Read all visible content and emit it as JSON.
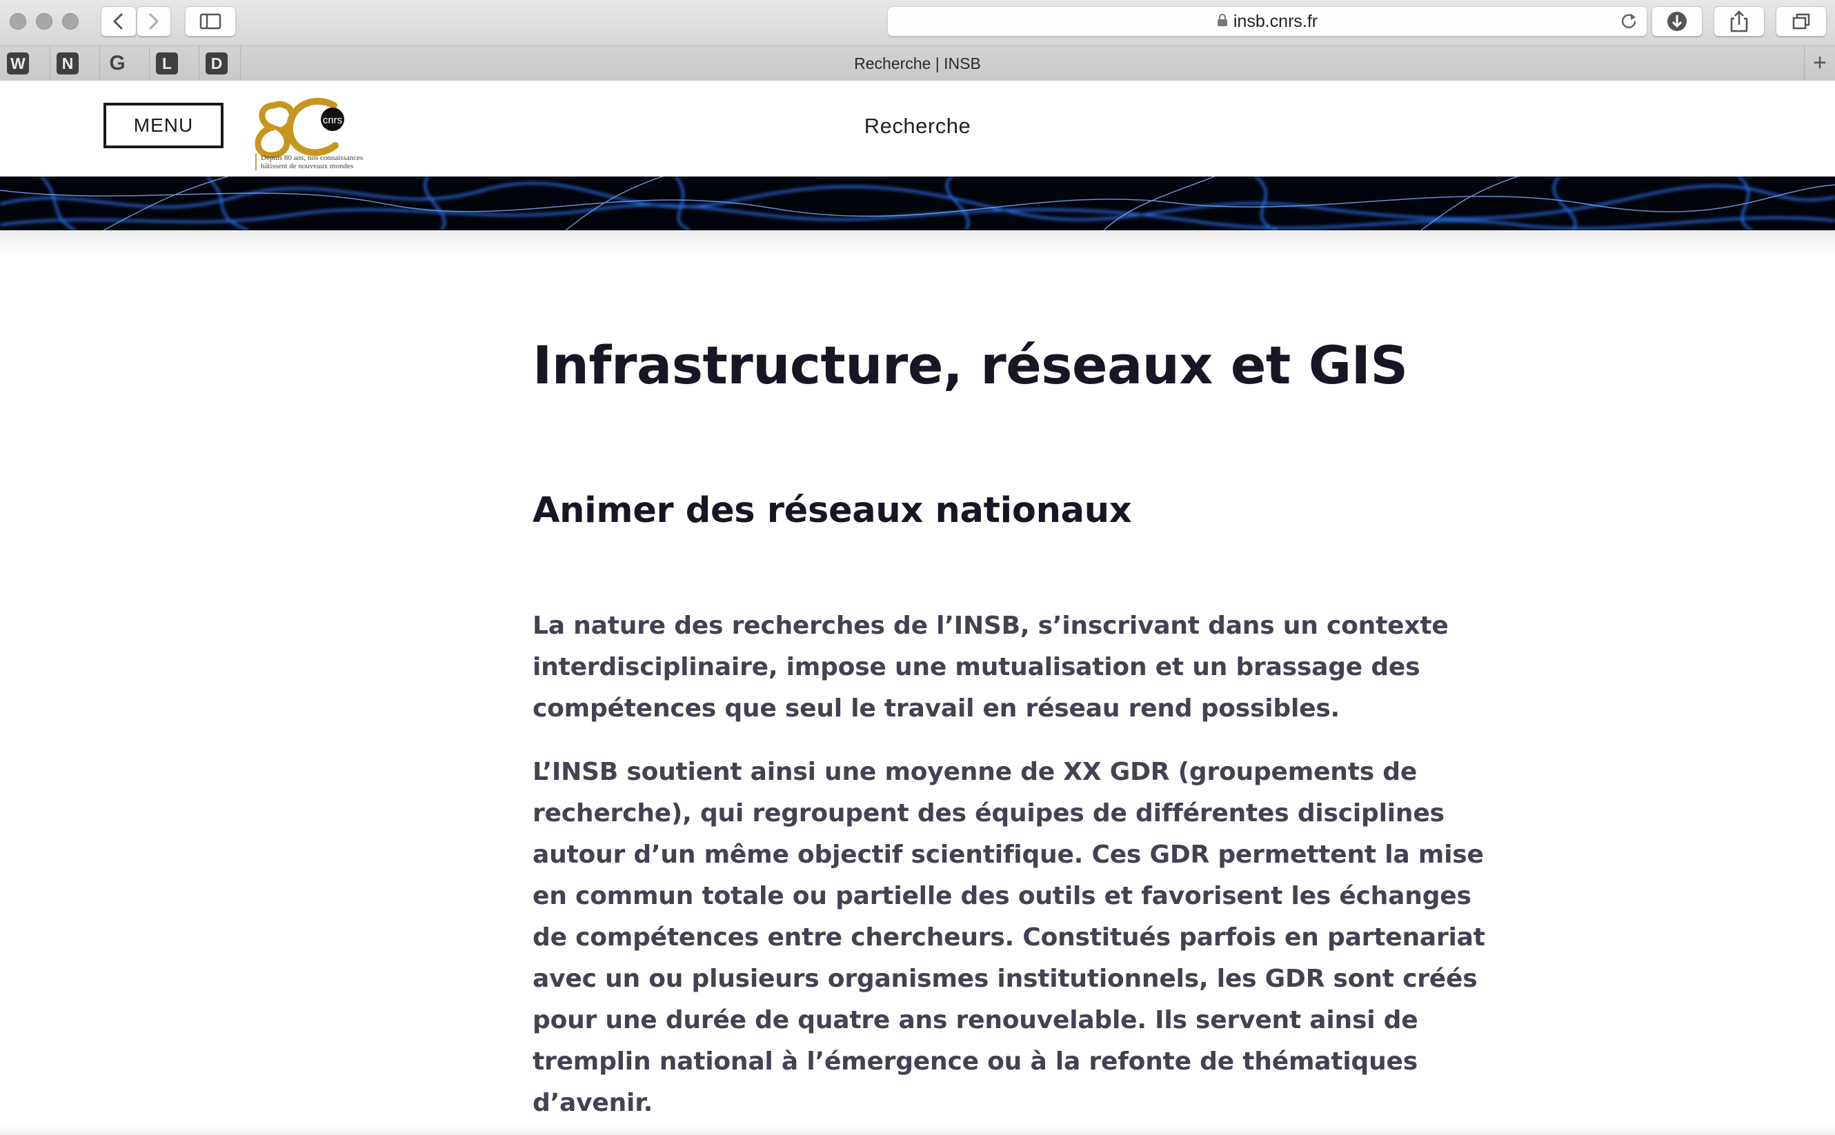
{
  "browser": {
    "url": "insb.cnrs.fr",
    "tab_title": "Recherche | INSB",
    "favorites": [
      "W",
      "N",
      "G",
      "L",
      "D"
    ],
    "new_tab_label": "+"
  },
  "header": {
    "menu_label": "MENU",
    "logo_caption_line1": "Depuis 80 ans, nos connaissances",
    "logo_caption_line2": "bâtissent de nouveaux mondes",
    "logo_badge": "cnrs",
    "section": "Recherche"
  },
  "main": {
    "title": "Infrastructure, réseaux et GIS",
    "subtitle": "Animer des réseaux nationaux",
    "paragraph1": [
      "La nature des recherches de l’INSB, s’inscrivant dans un contexte",
      "interdisciplinaire, impose une mutualisation et un brassage des",
      "compétences que seul le travail en réseau rend possibles."
    ],
    "paragraph2": [
      "L’INSB soutient ainsi une moyenne de XX GDR (groupements de",
      "recherche), qui regroupent des équipes de différentes disciplines",
      "autour d’un même objectif scientifique. Ces GDR permettent la mise",
      "en commun totale ou partielle des outils et favorisent les échanges",
      "de compétences entre chercheurs. Constitués parfois en partenariat",
      "avec un ou plusieurs organismes institutionnels, les GDR sont créés",
      "pour une durée de quatre ans renouvelable. Ils servent ainsi de",
      "tremplin national à l’émergence ou à la refonte de thématiques",
      "d’avenir."
    ]
  },
  "colors": {
    "title_text": "#161625",
    "body_text": "#424252",
    "logo_gold": "#c8961e",
    "banner_background": "#02040c",
    "banner_glow": "#2f7bff"
  },
  "icons": [
    "back-icon",
    "forward-icon",
    "sidebar-icon",
    "lock-icon",
    "reload-icon",
    "download-icon",
    "share-icon",
    "tabs-icon"
  ]
}
